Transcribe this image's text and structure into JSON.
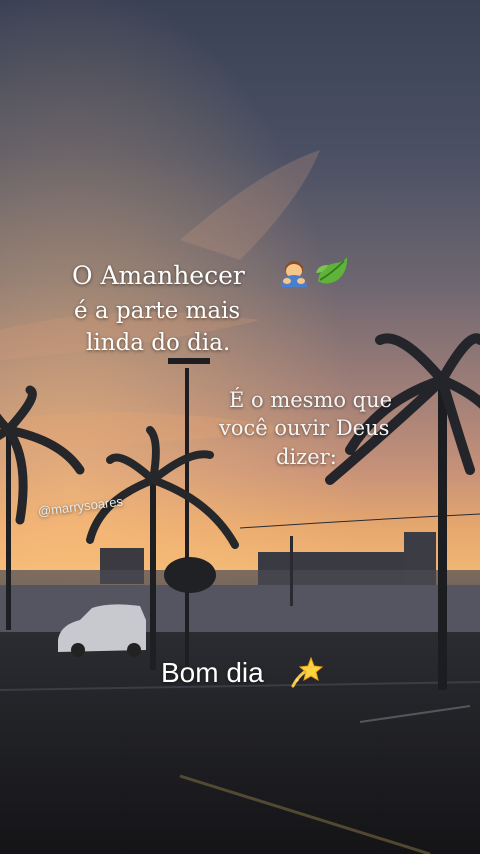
{
  "quote": {
    "line1": "O Amanhecer",
    "line2": "é a parte mais",
    "line3": "linda do dia.",
    "line4": "É o mesmo que",
    "line5": "você ouvir Deus",
    "line6": "dizer:"
  },
  "watermark": "@marrysoares",
  "caption": "Bom dia",
  "icons": {
    "title_icons": [
      "person-bowing-icon",
      "leaf-icon"
    ],
    "caption_icon": "dizzy-star-icon"
  },
  "colors": {
    "sky_top": "#3b4256",
    "sky_mid": "#8a6f73",
    "horizon_glow": "#f2b26a",
    "ground": "#1a1b1f"
  }
}
